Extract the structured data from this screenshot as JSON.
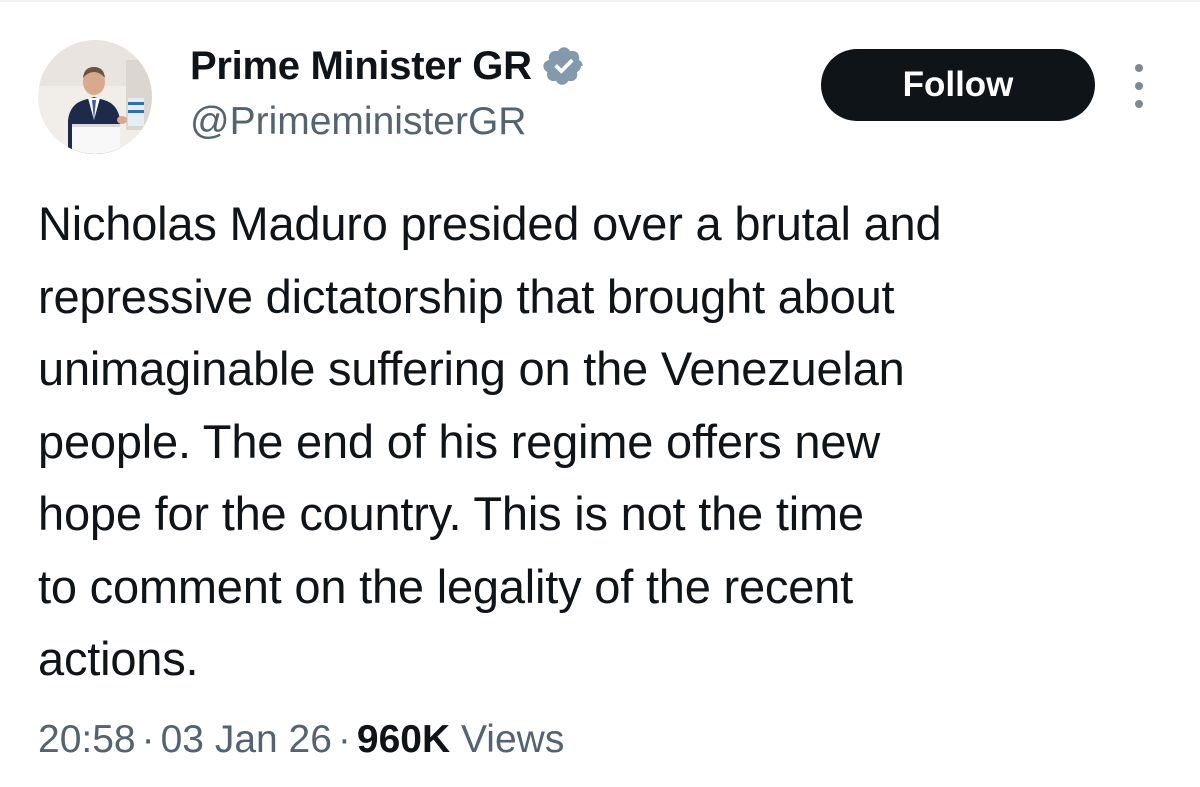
{
  "author": {
    "display_name": "Prime Minister GR",
    "handle": "@PrimeministerGR",
    "verified": true,
    "verified_badge_color": "#829aab"
  },
  "actions": {
    "follow_label": "Follow",
    "more_icon": "more-vertical-icon"
  },
  "tweet": {
    "text": "Nicholas Maduro presided over a brutal and\nrepressive dictatorship that brought about\nunimaginable suffering on the Venezuelan\npeople. The end of his regime offers new\nhope for the country. This is not the time\nto comment on the legality of the recent\nactions."
  },
  "meta": {
    "time": "20:58",
    "separator": "·",
    "date": "03 Jan 26",
    "views_count": "960K",
    "views_label": "Views"
  },
  "colors": {
    "text_primary": "#0f1419",
    "text_secondary": "#536471",
    "button_bg": "#0f1419",
    "button_text": "#ffffff"
  }
}
